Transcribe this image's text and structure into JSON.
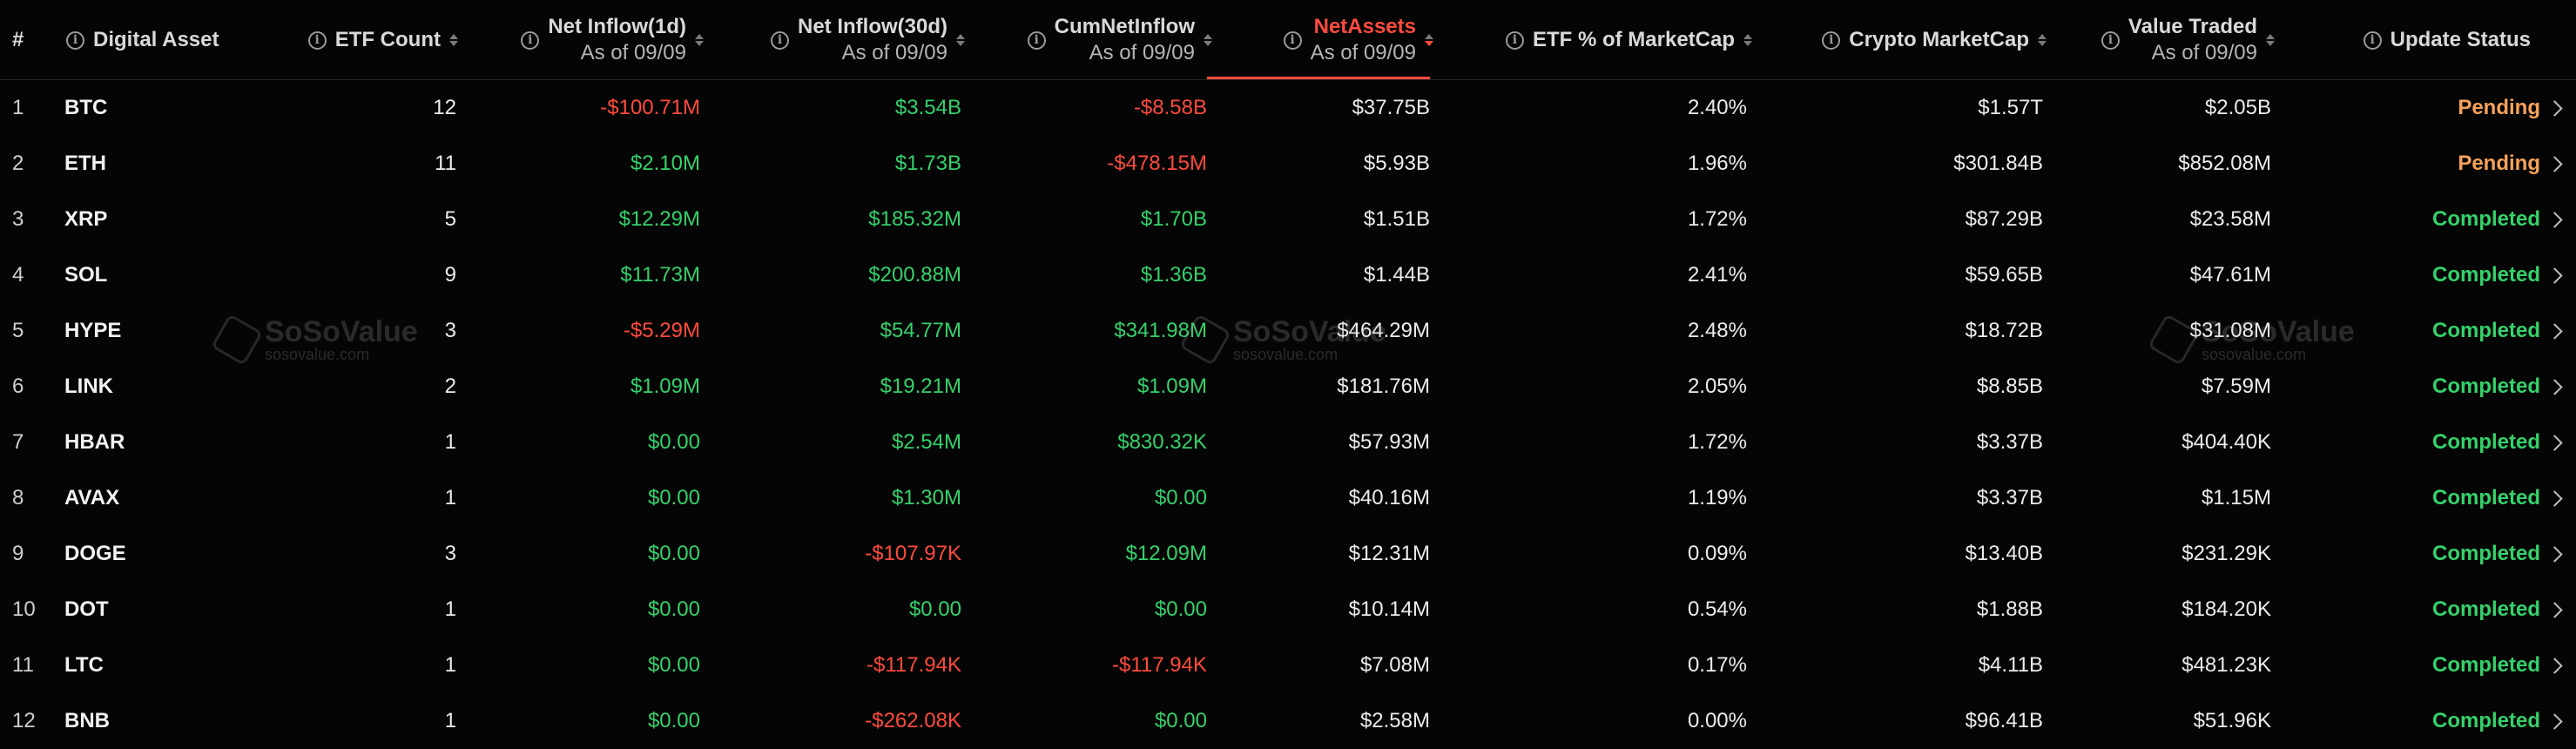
{
  "header": {
    "index": "#",
    "digital_asset": "Digital Asset",
    "etf_count": "ETF Count",
    "net_inflow_1d": "Net Inflow(1d)",
    "net_inflow_1d_sub": "As of 09/09",
    "net_inflow_30d": "Net Inflow(30d)",
    "net_inflow_30d_sub": "As of 09/09",
    "cum_net_inflow": "CumNetInflow",
    "cum_net_inflow_sub": "As of 09/09",
    "net_assets": "NetAssets",
    "net_assets_sub": "As of 09/09",
    "etf_pct_marketcap": "ETF % of MarketCap",
    "crypto_marketcap": "Crypto MarketCap",
    "value_traded": "Value Traded",
    "value_traded_sub": "As of 09/09",
    "update_status": "Update Status"
  },
  "watermark": {
    "name": "SoSoValue",
    "domain": "sosovalue.com"
  },
  "colors": {
    "positive": "#35d16b",
    "negative": "#ff4a3d",
    "pending": "#f5a25a",
    "active_sort": "#ff4b3e"
  },
  "rows": [
    {
      "n": "1",
      "asset": "BTC",
      "etf_count": "12",
      "inflow_1d": "-$100.71M",
      "inflow_1d_tone": "neg",
      "inflow_30d": "$3.54B",
      "inflow_30d_tone": "pos",
      "cum": "-$8.58B",
      "cum_tone": "neg",
      "net_assets": "$37.75B",
      "etf_pct": "2.40%",
      "mcap": "$1.57T",
      "traded": "$2.05B",
      "status": "Pending"
    },
    {
      "n": "2",
      "asset": "ETH",
      "etf_count": "11",
      "inflow_1d": "$2.10M",
      "inflow_1d_tone": "pos",
      "inflow_30d": "$1.73B",
      "inflow_30d_tone": "pos",
      "cum": "-$478.15M",
      "cum_tone": "neg",
      "net_assets": "$5.93B",
      "etf_pct": "1.96%",
      "mcap": "$301.84B",
      "traded": "$852.08M",
      "status": "Pending"
    },
    {
      "n": "3",
      "asset": "XRP",
      "etf_count": "5",
      "inflow_1d": "$12.29M",
      "inflow_1d_tone": "pos",
      "inflow_30d": "$185.32M",
      "inflow_30d_tone": "pos",
      "cum": "$1.70B",
      "cum_tone": "pos",
      "net_assets": "$1.51B",
      "etf_pct": "1.72%",
      "mcap": "$87.29B",
      "traded": "$23.58M",
      "status": "Completed"
    },
    {
      "n": "4",
      "asset": "SOL",
      "etf_count": "9",
      "inflow_1d": "$11.73M",
      "inflow_1d_tone": "pos",
      "inflow_30d": "$200.88M",
      "inflow_30d_tone": "pos",
      "cum": "$1.36B",
      "cum_tone": "pos",
      "net_assets": "$1.44B",
      "etf_pct": "2.41%",
      "mcap": "$59.65B",
      "traded": "$47.61M",
      "status": "Completed"
    },
    {
      "n": "5",
      "asset": "HYPE",
      "etf_count": "3",
      "inflow_1d": "-$5.29M",
      "inflow_1d_tone": "neg",
      "inflow_30d": "$54.77M",
      "inflow_30d_tone": "pos",
      "cum": "$341.98M",
      "cum_tone": "pos",
      "net_assets": "$464.29M",
      "etf_pct": "2.48%",
      "mcap": "$18.72B",
      "traded": "$31.08M",
      "status": "Completed"
    },
    {
      "n": "6",
      "asset": "LINK",
      "etf_count": "2",
      "inflow_1d": "$1.09M",
      "inflow_1d_tone": "pos",
      "inflow_30d": "$19.21M",
      "inflow_30d_tone": "pos",
      "cum": "$1.09M",
      "cum_tone": "pos",
      "net_assets": "$181.76M",
      "etf_pct": "2.05%",
      "mcap": "$8.85B",
      "traded": "$7.59M",
      "status": "Completed"
    },
    {
      "n": "7",
      "asset": "HBAR",
      "etf_count": "1",
      "inflow_1d": "$0.00",
      "inflow_1d_tone": "pos",
      "inflow_30d": "$2.54M",
      "inflow_30d_tone": "pos",
      "cum": "$830.32K",
      "cum_tone": "pos",
      "net_assets": "$57.93M",
      "etf_pct": "1.72%",
      "mcap": "$3.37B",
      "traded": "$404.40K",
      "status": "Completed"
    },
    {
      "n": "8",
      "asset": "AVAX",
      "etf_count": "1",
      "inflow_1d": "$0.00",
      "inflow_1d_tone": "pos",
      "inflow_30d": "$1.30M",
      "inflow_30d_tone": "pos",
      "cum": "$0.00",
      "cum_tone": "pos",
      "net_assets": "$40.16M",
      "etf_pct": "1.19%",
      "mcap": "$3.37B",
      "traded": "$1.15M",
      "status": "Completed"
    },
    {
      "n": "9",
      "asset": "DOGE",
      "etf_count": "3",
      "inflow_1d": "$0.00",
      "inflow_1d_tone": "pos",
      "inflow_30d": "-$107.97K",
      "inflow_30d_tone": "neg",
      "cum": "$12.09M",
      "cum_tone": "pos",
      "net_assets": "$12.31M",
      "etf_pct": "0.09%",
      "mcap": "$13.40B",
      "traded": "$231.29K",
      "status": "Completed"
    },
    {
      "n": "10",
      "asset": "DOT",
      "etf_count": "1",
      "inflow_1d": "$0.00",
      "inflow_1d_tone": "pos",
      "inflow_30d": "$0.00",
      "inflow_30d_tone": "pos",
      "cum": "$0.00",
      "cum_tone": "pos",
      "net_assets": "$10.14M",
      "etf_pct": "0.54%",
      "mcap": "$1.88B",
      "traded": "$184.20K",
      "status": "Completed"
    },
    {
      "n": "11",
      "asset": "LTC",
      "etf_count": "1",
      "inflow_1d": "$0.00",
      "inflow_1d_tone": "pos",
      "inflow_30d": "-$117.94K",
      "inflow_30d_tone": "neg",
      "cum": "-$117.94K",
      "cum_tone": "neg",
      "net_assets": "$7.08M",
      "etf_pct": "0.17%",
      "mcap": "$4.11B",
      "traded": "$481.23K",
      "status": "Completed"
    },
    {
      "n": "12",
      "asset": "BNB",
      "etf_count": "1",
      "inflow_1d": "$0.00",
      "inflow_1d_tone": "pos",
      "inflow_30d": "-$262.08K",
      "inflow_30d_tone": "neg",
      "cum": "$0.00",
      "cum_tone": "pos",
      "net_assets": "$2.58M",
      "etf_pct": "0.00%",
      "mcap": "$96.41B",
      "traded": "$51.96K",
      "status": "Completed"
    }
  ]
}
